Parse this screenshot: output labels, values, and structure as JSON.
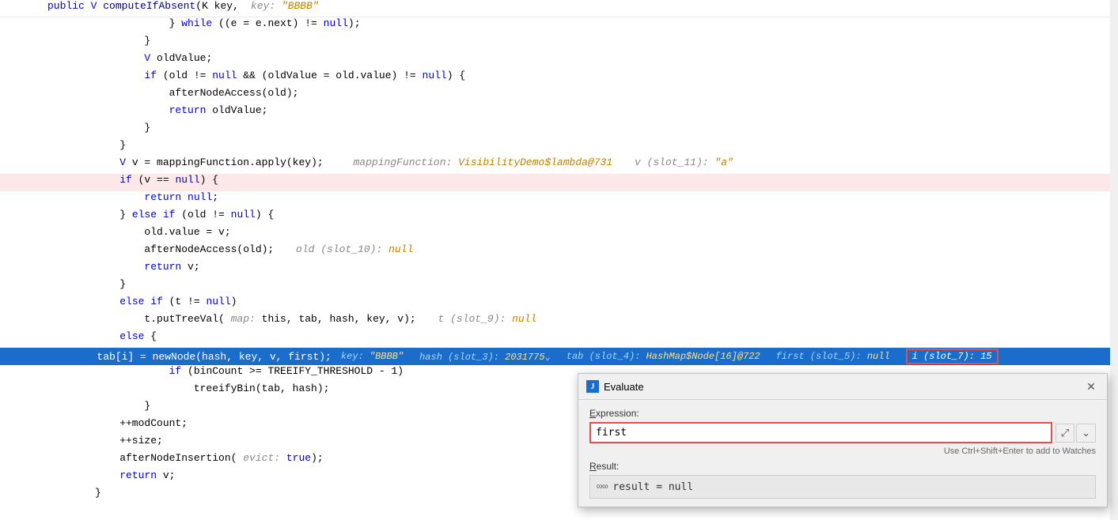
{
  "editor": {
    "lines": [
      {
        "num": "",
        "content": "fn_signature",
        "text": "public V computeIfAbsent(K key,",
        "hint": "key: \"BBBB\""
      }
    ],
    "code_lines": [
      {
        "num": "",
        "indent": 3,
        "text": "} while ((e = e.next) != null);",
        "style": "normal"
      },
      {
        "num": "",
        "indent": 2,
        "text": "}",
        "style": "normal"
      },
      {
        "num": "",
        "indent": 2,
        "text": "V oldValue;",
        "style": "normal"
      },
      {
        "num": "",
        "indent": 2,
        "text": "if (old != null && (oldValue = old.value) != null) {",
        "style": "normal"
      },
      {
        "num": "",
        "indent": 3,
        "text": "afterNodeAccess(old);",
        "style": "normal"
      },
      {
        "num": "",
        "indent": 3,
        "text": "return oldValue;",
        "style": "normal"
      },
      {
        "num": "",
        "indent": 2,
        "text": "}",
        "style": "normal"
      },
      {
        "num": "",
        "indent": 1,
        "text": "}",
        "style": "normal"
      },
      {
        "num": "",
        "indent": 1,
        "text": "V v = mappingFunction.apply(key);",
        "hint1": "mappingFunction: VisibilityDemo$lambda@731",
        "hint2": "v (slot_11): \"a\"",
        "style": "normal"
      },
      {
        "num": "",
        "indent": 1,
        "text": "if (v == null) {",
        "style": "highlighted"
      },
      {
        "num": "",
        "indent": 2,
        "text": "return null;",
        "style": "normal"
      },
      {
        "num": "",
        "indent": 1,
        "text": "} else if (old != null) {",
        "style": "normal"
      },
      {
        "num": "",
        "indent": 2,
        "text": "old.value = v;",
        "style": "normal"
      },
      {
        "num": "",
        "indent": 2,
        "text": "afterNodeAccess(old);",
        "hint": "old (slot_10): null",
        "style": "normal"
      },
      {
        "num": "",
        "indent": 2,
        "text": "return v;",
        "style": "normal"
      },
      {
        "num": "",
        "indent": 1,
        "text": "}",
        "style": "normal"
      },
      {
        "num": "",
        "indent": 1,
        "text": "else if (t != null)",
        "style": "normal"
      },
      {
        "num": "",
        "indent": 2,
        "text": "t.putTreeVal( map: this, tab, hash, key, v);",
        "hint": "t (slot_9): null",
        "style": "normal"
      },
      {
        "num": "",
        "indent": 1,
        "text": "else {",
        "style": "normal"
      },
      {
        "num": "",
        "indent": 2,
        "text": "tab[i] = newNode(hash, key, v, first);",
        "style": "selected",
        "hints": [
          {
            "label": "key:",
            "value": "\"BBBB\""
          },
          {
            "label": "hash (slot_3):",
            "value": "2031775",
            "arrow": true
          },
          {
            "label": "tab (slot_4):",
            "value": "HashMap$Node[16]@722"
          },
          {
            "label": "first (slot_5):",
            "value": "null"
          }
        ],
        "slot7": "i (slot_7): 15"
      },
      {
        "num": "",
        "indent": 3,
        "text": "if (binCount >= TREEIFY_THRESHOLD - 1)",
        "style": "normal"
      },
      {
        "num": "",
        "indent": 4,
        "text": "treeifyBin(tab, hash);",
        "style": "normal"
      },
      {
        "num": "",
        "indent": 2,
        "text": "}",
        "style": "normal"
      },
      {
        "num": "",
        "indent": 1,
        "text": "++modCount;",
        "style": "normal"
      },
      {
        "num": "",
        "indent": 1,
        "text": "++size;",
        "style": "normal"
      },
      {
        "num": "",
        "indent": 1,
        "text": "afterNodeInsertion( evict: true);",
        "style": "normal"
      },
      {
        "num": "",
        "indent": 1,
        "text": "return v;",
        "style": "normal"
      },
      {
        "num": "",
        "indent": 0,
        "text": "}",
        "style": "normal"
      }
    ]
  },
  "dialog": {
    "title": "Evaluate",
    "icon_letter": "J",
    "expression_label": "Expression:",
    "expression_value": "first",
    "ctrl_hint": "Use Ctrl+Shift+Enter to add to Watches",
    "result_label": "Result:",
    "result_icon": "∞",
    "result_text": "result = null",
    "expand_icon": "⤢",
    "collapse_icon": "⌄",
    "close_icon": "✕"
  }
}
